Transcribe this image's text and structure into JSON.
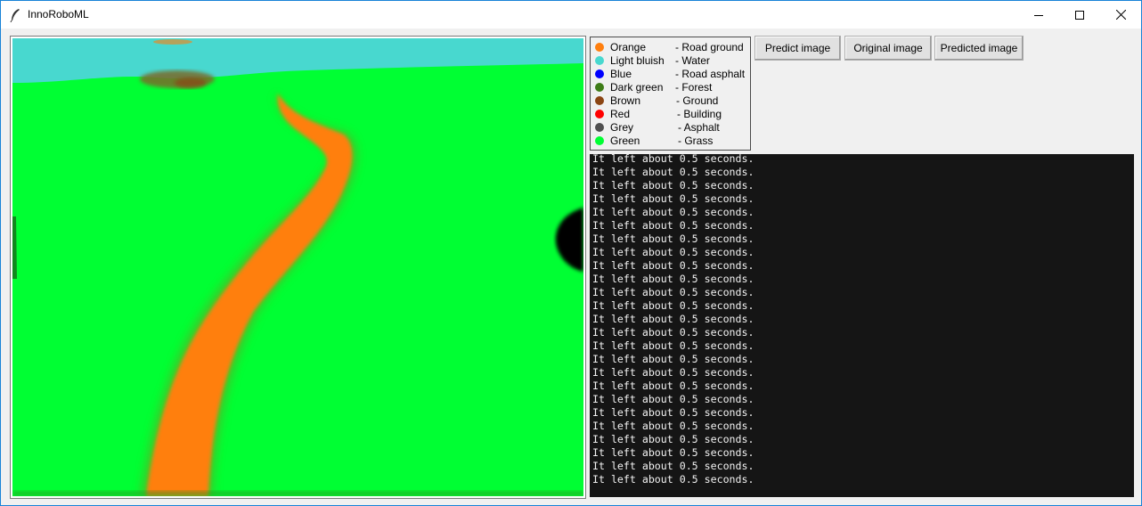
{
  "window": {
    "title": "InnoRoboML",
    "icons": {
      "app": "feather-icon",
      "minimize": "minimize-icon",
      "maximize": "maximize-icon",
      "close": "close-icon"
    }
  },
  "legend": [
    {
      "color_name": "Orange",
      "class_name": "-  Road ground",
      "color": "#ff7f0e"
    },
    {
      "color_name": "Light bluish",
      "class_name": "-  Water",
      "color": "#48d8cf"
    },
    {
      "color_name": "Blue",
      "class_name": "-  Road asphalt",
      "color": "#0000ff"
    },
    {
      "color_name": "Dark green",
      "class_name": "-  Forest",
      "color": "#3e7c17"
    },
    {
      "color_name": "Brown",
      "class_name": "-  Ground",
      "color": "#8b4513"
    },
    {
      "color_name": "Red",
      "class_name": "-  Building",
      "color": "#ff0000"
    },
    {
      "color_name": "Grey",
      "class_name": "-  Asphalt",
      "color": "#4f4f4f"
    },
    {
      "color_name": "Green",
      "class_name": "-  Grass",
      "color": "#00ff33"
    }
  ],
  "buttons": {
    "predict": "Predict image",
    "original": "Original image",
    "predicted": "Predicted image"
  },
  "console": {
    "lines": [
      "It left about 0.5 seconds.",
      "It left about 0.5 seconds.",
      "It left about 0.5 seconds.",
      "It left about 0.5 seconds.",
      "It left about 0.5 seconds.",
      "It left about 0.5 seconds.",
      "It left about 0.5 seconds.",
      "It left about 0.5 seconds.",
      "It left about 0.5 seconds.",
      "It left about 0.5 seconds.",
      "It left about 0.5 seconds.",
      "It left about 0.5 seconds.",
      "It left about 0.5 seconds.",
      "It left about 0.5 seconds.",
      "It left about 0.5 seconds.",
      "It left about 0.5 seconds.",
      "It left about 0.5 seconds.",
      "It left about 0.5 seconds.",
      "It left about 0.5 seconds.",
      "It left about 0.5 seconds.",
      "It left about 0.5 seconds.",
      "It left about 0.5 seconds.",
      "It left about 0.5 seconds.",
      "It left about 0.5 seconds.",
      "It left about 0.5 seconds.",
      "It left about 0.5 seconds."
    ]
  },
  "segmentation_colors": {
    "grass": "#00ff33",
    "road_ground": "#ff7f0e",
    "water": "#48d8cf",
    "ground": "#8b4513",
    "shadow": "#000000"
  }
}
